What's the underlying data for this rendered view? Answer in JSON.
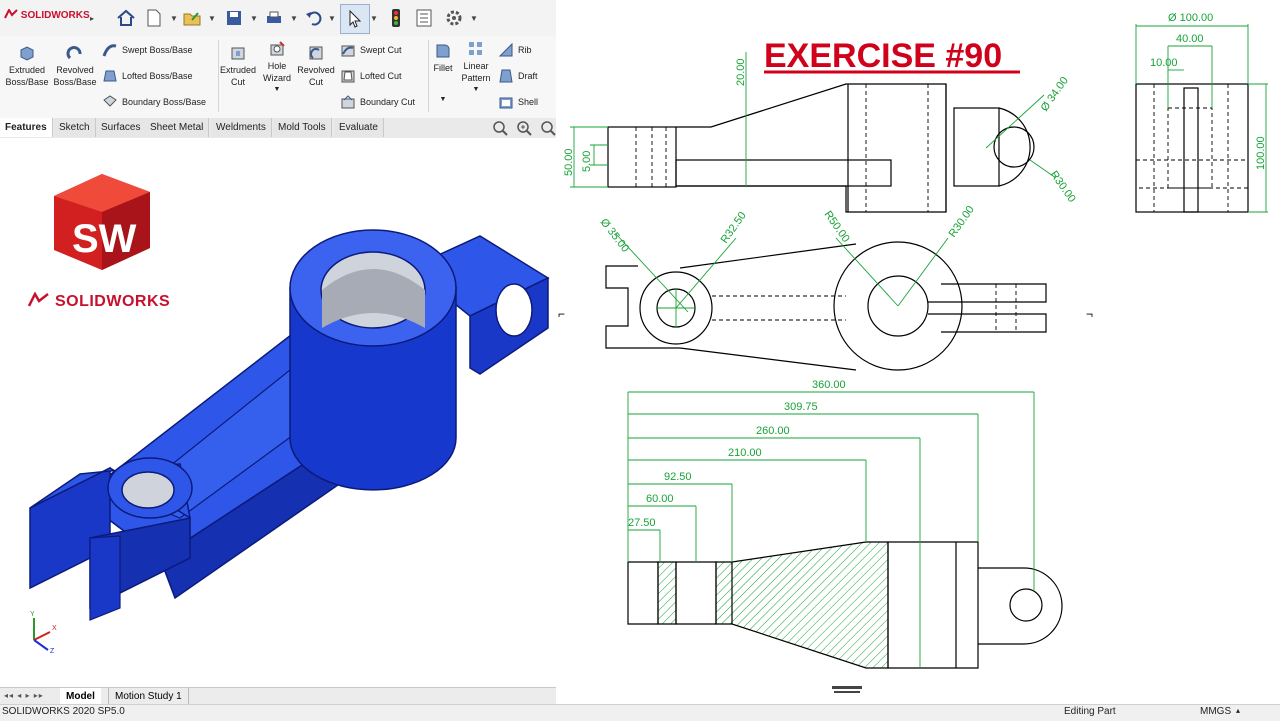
{
  "app": {
    "logo": "SOLIDWORKS"
  },
  "toolbar": {
    "icons": [
      "home-icon",
      "new-document-icon",
      "open-icon",
      "save-icon",
      "print-icon",
      "undo-icon",
      "select-icon",
      "rebuild-icon",
      "file-properties-icon",
      "options-icon"
    ]
  },
  "ribbon": {
    "extruded_boss": "Extruded\nBoss/Base",
    "revolved_boss": "Revolved\nBoss/Base",
    "swept_boss": "Swept Boss/Base",
    "lofted_boss": "Lofted Boss/Base",
    "boundary_boss": "Boundary Boss/Base",
    "extruded_cut": "Extruded\nCut",
    "hole_wizard": "Hole\nWizard",
    "revolved_cut": "Revolved\nCut",
    "swept_cut": "Swept Cut",
    "lofted_cut": "Lofted Cut",
    "boundary_cut": "Boundary Cut",
    "fillet": "Fillet",
    "linear_pattern": "Linear\nPattern",
    "rib": "Rib",
    "draft": "Draft",
    "shell": "Shell"
  },
  "tabs": [
    "Features",
    "Sketch",
    "Surfaces",
    "Sheet Metal",
    "Weldments",
    "Mold Tools",
    "Evaluate"
  ],
  "brand": {
    "sw_letters": "SW",
    "wordmark": "SOLIDWORKS"
  },
  "triad": {
    "y": "Y",
    "x": "X",
    "z": "Z"
  },
  "bottom_tabs": {
    "model": "Model",
    "motion": "Motion Study 1"
  },
  "status": {
    "version": "SOLIDWORKS 2020 SP5.0",
    "mode": "Editing Part",
    "units": "MMGS"
  },
  "drawing": {
    "title": "EXERCISE #90",
    "dims": {
      "d100": "Ø 100.00",
      "d40": "40.00",
      "d10": "10.00",
      "r100": "100.00",
      "d20": "20.00",
      "d50": "50.00",
      "d5": "5.00",
      "d34": "Ø 34.00",
      "r30a": "R30.00",
      "d35": "Ø 35.00",
      "r325": "R32.50",
      "r50": "R50.00",
      "r30b": "R30.00",
      "l360": "360.00",
      "l30975": "309.75",
      "l260": "260.00",
      "l210": "210.00",
      "l925": "92.50",
      "l60": "60.00",
      "l275": "27.50"
    }
  },
  "colors": {
    "accent_red": "#d0021b",
    "dim_green": "#18a338",
    "part_blue": "#1f3fd6"
  }
}
